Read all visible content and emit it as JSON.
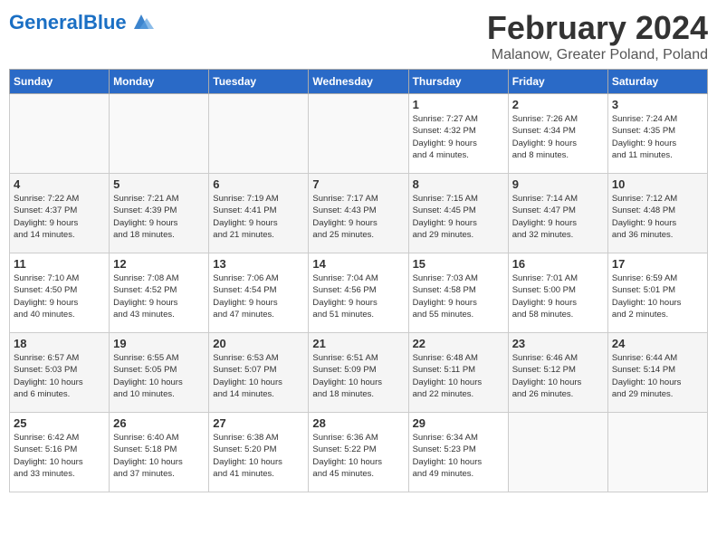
{
  "header": {
    "logo_general": "General",
    "logo_blue": "Blue",
    "main_title": "February 2024",
    "subtitle": "Malanow, Greater Poland, Poland"
  },
  "weekdays": [
    "Sunday",
    "Monday",
    "Tuesday",
    "Wednesday",
    "Thursday",
    "Friday",
    "Saturday"
  ],
  "weeks": [
    [
      {
        "day": "",
        "info": ""
      },
      {
        "day": "",
        "info": ""
      },
      {
        "day": "",
        "info": ""
      },
      {
        "day": "",
        "info": ""
      },
      {
        "day": "1",
        "info": "Sunrise: 7:27 AM\nSunset: 4:32 PM\nDaylight: 9 hours\nand 4 minutes."
      },
      {
        "day": "2",
        "info": "Sunrise: 7:26 AM\nSunset: 4:34 PM\nDaylight: 9 hours\nand 8 minutes."
      },
      {
        "day": "3",
        "info": "Sunrise: 7:24 AM\nSunset: 4:35 PM\nDaylight: 9 hours\nand 11 minutes."
      }
    ],
    [
      {
        "day": "4",
        "info": "Sunrise: 7:22 AM\nSunset: 4:37 PM\nDaylight: 9 hours\nand 14 minutes."
      },
      {
        "day": "5",
        "info": "Sunrise: 7:21 AM\nSunset: 4:39 PM\nDaylight: 9 hours\nand 18 minutes."
      },
      {
        "day": "6",
        "info": "Sunrise: 7:19 AM\nSunset: 4:41 PM\nDaylight: 9 hours\nand 21 minutes."
      },
      {
        "day": "7",
        "info": "Sunrise: 7:17 AM\nSunset: 4:43 PM\nDaylight: 9 hours\nand 25 minutes."
      },
      {
        "day": "8",
        "info": "Sunrise: 7:15 AM\nSunset: 4:45 PM\nDaylight: 9 hours\nand 29 minutes."
      },
      {
        "day": "9",
        "info": "Sunrise: 7:14 AM\nSunset: 4:47 PM\nDaylight: 9 hours\nand 32 minutes."
      },
      {
        "day": "10",
        "info": "Sunrise: 7:12 AM\nSunset: 4:48 PM\nDaylight: 9 hours\nand 36 minutes."
      }
    ],
    [
      {
        "day": "11",
        "info": "Sunrise: 7:10 AM\nSunset: 4:50 PM\nDaylight: 9 hours\nand 40 minutes."
      },
      {
        "day": "12",
        "info": "Sunrise: 7:08 AM\nSunset: 4:52 PM\nDaylight: 9 hours\nand 43 minutes."
      },
      {
        "day": "13",
        "info": "Sunrise: 7:06 AM\nSunset: 4:54 PM\nDaylight: 9 hours\nand 47 minutes."
      },
      {
        "day": "14",
        "info": "Sunrise: 7:04 AM\nSunset: 4:56 PM\nDaylight: 9 hours\nand 51 minutes."
      },
      {
        "day": "15",
        "info": "Sunrise: 7:03 AM\nSunset: 4:58 PM\nDaylight: 9 hours\nand 55 minutes."
      },
      {
        "day": "16",
        "info": "Sunrise: 7:01 AM\nSunset: 5:00 PM\nDaylight: 9 hours\nand 58 minutes."
      },
      {
        "day": "17",
        "info": "Sunrise: 6:59 AM\nSunset: 5:01 PM\nDaylight: 10 hours\nand 2 minutes."
      }
    ],
    [
      {
        "day": "18",
        "info": "Sunrise: 6:57 AM\nSunset: 5:03 PM\nDaylight: 10 hours\nand 6 minutes."
      },
      {
        "day": "19",
        "info": "Sunrise: 6:55 AM\nSunset: 5:05 PM\nDaylight: 10 hours\nand 10 minutes."
      },
      {
        "day": "20",
        "info": "Sunrise: 6:53 AM\nSunset: 5:07 PM\nDaylight: 10 hours\nand 14 minutes."
      },
      {
        "day": "21",
        "info": "Sunrise: 6:51 AM\nSunset: 5:09 PM\nDaylight: 10 hours\nand 18 minutes."
      },
      {
        "day": "22",
        "info": "Sunrise: 6:48 AM\nSunset: 5:11 PM\nDaylight: 10 hours\nand 22 minutes."
      },
      {
        "day": "23",
        "info": "Sunrise: 6:46 AM\nSunset: 5:12 PM\nDaylight: 10 hours\nand 26 minutes."
      },
      {
        "day": "24",
        "info": "Sunrise: 6:44 AM\nSunset: 5:14 PM\nDaylight: 10 hours\nand 29 minutes."
      }
    ],
    [
      {
        "day": "25",
        "info": "Sunrise: 6:42 AM\nSunset: 5:16 PM\nDaylight: 10 hours\nand 33 minutes."
      },
      {
        "day": "26",
        "info": "Sunrise: 6:40 AM\nSunset: 5:18 PM\nDaylight: 10 hours\nand 37 minutes."
      },
      {
        "day": "27",
        "info": "Sunrise: 6:38 AM\nSunset: 5:20 PM\nDaylight: 10 hours\nand 41 minutes."
      },
      {
        "day": "28",
        "info": "Sunrise: 6:36 AM\nSunset: 5:22 PM\nDaylight: 10 hours\nand 45 minutes."
      },
      {
        "day": "29",
        "info": "Sunrise: 6:34 AM\nSunset: 5:23 PM\nDaylight: 10 hours\nand 49 minutes."
      },
      {
        "day": "",
        "info": ""
      },
      {
        "day": "",
        "info": ""
      }
    ]
  ]
}
